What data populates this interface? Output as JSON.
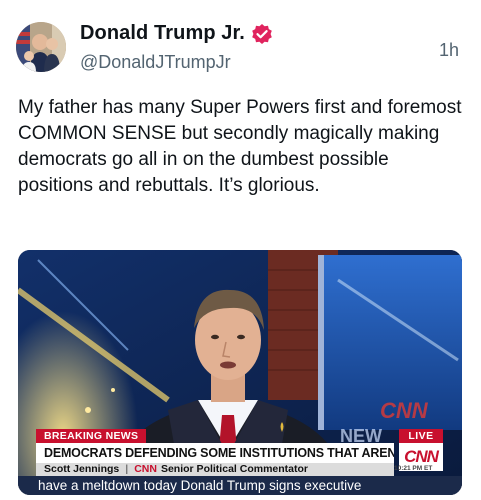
{
  "author": {
    "display_name": "Donald Trump Jr.",
    "handle": "@DonaldJTrumpJr",
    "verified_icon": "verified-badge-icon",
    "verified_color": "#e0245e"
  },
  "post": {
    "time": "1h",
    "text": "My father has many Super Powers first and foremost COMMON SENSE but secondly magically making democrats go all in on the dumbest possible positions and rebuttals. It’s glorious."
  },
  "media": {
    "breaking_label": "BREAKING NEWS",
    "live_label": "LIVE",
    "headline": "DEMOCRATS DEFENDING SOME INSTITUTIONS THAT AREN'T POPULAR",
    "network_logo": "CNN",
    "name_line": {
      "name": "Scott Jennings",
      "network": "CNN",
      "title": "Senior Political Commentator"
    },
    "ticker": "have a meltdown today Donald Trump signs executive",
    "clock": "10:21 PM ET",
    "colors": {
      "breaking_red": "#c8102e",
      "ticker_navy": "#1b2a4a"
    }
  }
}
